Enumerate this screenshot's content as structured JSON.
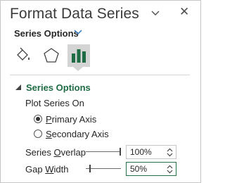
{
  "header": {
    "title": "Format Data Series",
    "dropdown_icon": "chevron-down-icon",
    "close_icon": "close-icon",
    "close_glyph": "✕"
  },
  "options_selector": {
    "label": "Series Options"
  },
  "icon_tabs": [
    {
      "name": "fill-line-tab",
      "icon": "paint-bucket-icon"
    },
    {
      "name": "effects-tab",
      "icon": "pentagon-icon"
    },
    {
      "name": "series-options-tab",
      "icon": "bar-chart-icon",
      "selected": true
    }
  ],
  "section": {
    "title": "Series Options",
    "plot_series_on": "Plot Series On",
    "primary": {
      "before": "",
      "u": "P",
      "after": "rimary Axis",
      "checked": true
    },
    "secondary": {
      "before": "",
      "u": "S",
      "after": "econdary Axis",
      "checked": false
    },
    "series_overlap": {
      "before": "Series ",
      "u": "O",
      "after": "verlap",
      "value": "100%",
      "level": 1.0
    },
    "gap_width": {
      "before": "Gap ",
      "u": "W",
      "after": "idth",
      "value": "50%",
      "level": 0.1
    }
  },
  "colors": {
    "accent_green": "#1e6b44",
    "focus_border": "#217346",
    "selected_tab_bg": "#d4d4d4"
  }
}
